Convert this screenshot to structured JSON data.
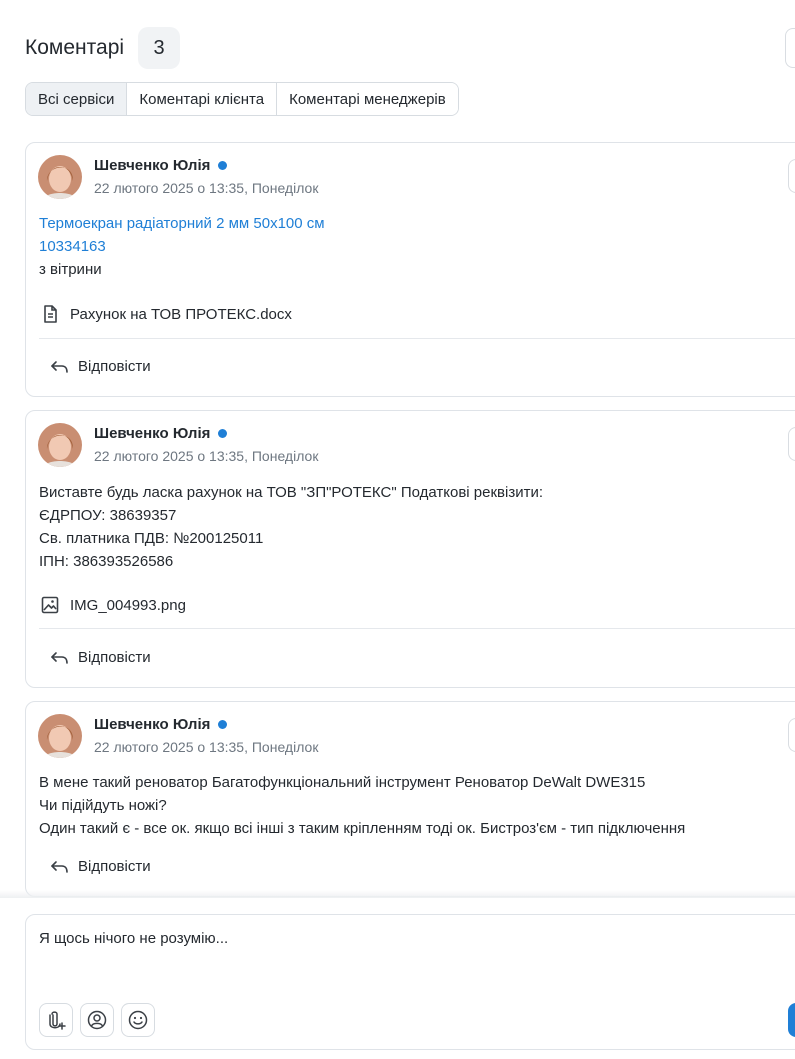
{
  "header": {
    "title": "Коментарі",
    "count": "3"
  },
  "tabs": [
    {
      "label": "Всі сервіси",
      "active": true
    },
    {
      "label": "Коментарі клієнта",
      "active": false
    },
    {
      "label": "Коментарі менеджерів",
      "active": false
    }
  ],
  "comments": [
    {
      "author": "Шевченко Юлія",
      "timestamp": "22 лютого 2025 о 13:35, Понеділок",
      "link_title": "Термоекран радіаторний 2 мм 50х100 см",
      "link_code": "10334163",
      "text": "з вітрини",
      "attachment": {
        "name": "Рахунок на ТОВ ПРОТЕКС.docx",
        "icon": "document-icon"
      },
      "reply_label": "Відповісти"
    },
    {
      "author": "Шевченко Юлія",
      "timestamp": "22 лютого 2025 о 13:35, Понеділок",
      "lines": [
        "Виставте будь ласка рахунок на ТОВ \"ЗП\"РОТЕКС\" Податкові реквізити:",
        "ЄДРПОУ: 38639357",
        "Св. платника ПДВ: №200125011",
        "ІПН: 386393526586"
      ],
      "attachment": {
        "name": "IMG_004993.png",
        "icon": "image-icon"
      },
      "reply_label": "Відповісти"
    },
    {
      "author": "Шевченко Юлія",
      "timestamp": "22 лютого 2025 о 13:35, Понеділок",
      "lines": [
        "В мене такий реноватор Багатофункціональний інструмент Реноватор DeWalt DWE315",
        "Чи підійдуть ножі?",
        "Один такий є - все ок. якщо всі інші з таким кріпленням тоді ок. Бистроз'єм - тип підключення"
      ],
      "reply_label": "Відповісти"
    }
  ],
  "composer": {
    "text": "Я щось нічого не розумію...",
    "tools": [
      "attach-icon",
      "mention-icon",
      "emoji-icon"
    ]
  },
  "colors": {
    "accent": "#1f7fd6",
    "border": "#dfe3e8",
    "muted": "#6e7781"
  }
}
